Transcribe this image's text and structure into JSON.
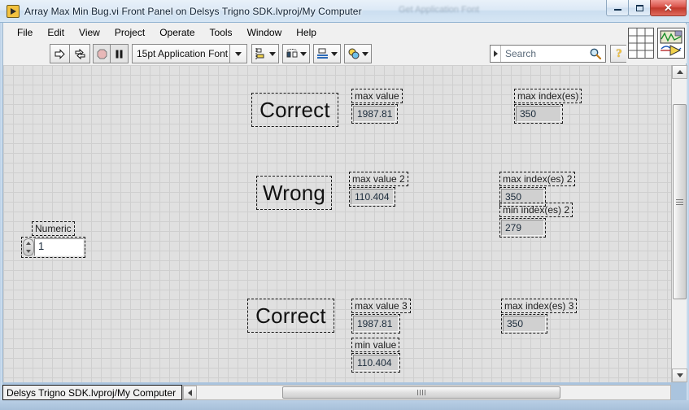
{
  "window": {
    "title": "Array Max Min Bug.vi Front Panel on Delsys Trigno SDK.lvproj/My Computer",
    "ghost_title": "Get Application Font",
    "app_icon": "labview-vi-icon",
    "buttons": {
      "minimize": "minimize-button",
      "restore": "restore-button",
      "close_label": "✕"
    }
  },
  "menubar": {
    "items": [
      {
        "label": "File"
      },
      {
        "label": "Edit"
      },
      {
        "label": "View"
      },
      {
        "label": "Project"
      },
      {
        "label": "Operate"
      },
      {
        "label": "Tools"
      },
      {
        "label": "Window"
      },
      {
        "label": "Help"
      }
    ]
  },
  "toolbar": {
    "run_icon": "run-arrow-icon",
    "run_continuous_icon": "run-continuously-icon",
    "abort_icon": "abort-execution-icon",
    "pause_icon": "pause-icon",
    "font_selector": "15pt Application Font",
    "align_icon": "align-objects-icon",
    "distribute_icon": "distribute-objects-icon",
    "resize_icon": "resize-objects-icon",
    "reorder_icon": "reorder-objects-icon"
  },
  "search": {
    "placeholder": "Search",
    "value": "Search",
    "icon": "magnifier-icon"
  },
  "help_button": {
    "label": "?"
  },
  "icon_panel": {
    "grid_icon": "connector-pane-icon",
    "vi_icon": "vi-icon"
  },
  "front_panel": {
    "verdicts": [
      {
        "text": "Correct"
      },
      {
        "text": "Wrong"
      },
      {
        "text": "Correct"
      }
    ],
    "indicators": [
      {
        "label": "max value",
        "value": "1987.81"
      },
      {
        "label": "max index(es)",
        "value": "350"
      },
      {
        "label": "max value 2",
        "value": "110.404"
      },
      {
        "label": "max index(es) 2",
        "value": "350"
      },
      {
        "label": "min index(es) 2",
        "value": "279"
      },
      {
        "label": "max value 3",
        "value": "1987.81"
      },
      {
        "label": "min value",
        "value": "110.404"
      },
      {
        "label": "max index(es) 3",
        "value": "350"
      }
    ],
    "numeric_control": {
      "label": "Numeric",
      "value": "1"
    }
  },
  "statusbar": {
    "text": "Delsys Trigno SDK.lvproj/My Computer"
  },
  "scrollbars": {
    "vertical": "vertical-scrollbar",
    "horizontal": "horizontal-scrollbar"
  }
}
